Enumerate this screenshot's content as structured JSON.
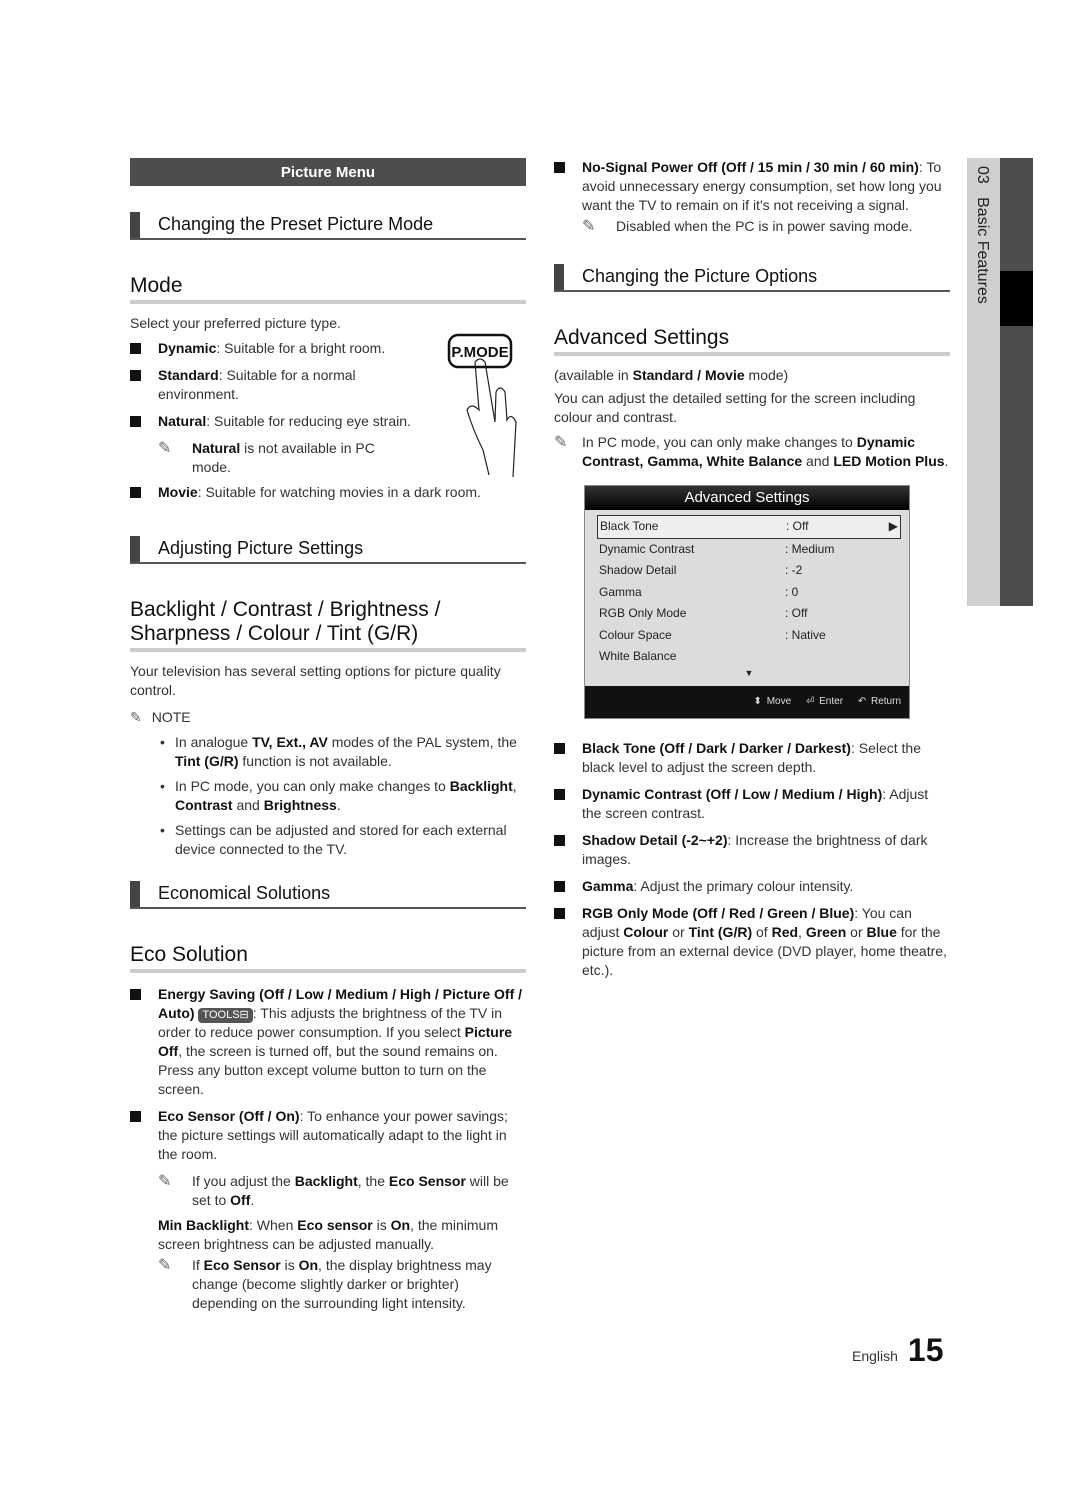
{
  "left": {
    "menu_bar": "Picture Menu",
    "sub1": "Changing the Preset Picture Mode",
    "h_mode": "Mode",
    "mode_intro": "Select your preferred picture type.",
    "mode_items": [
      {
        "term": "Dynamic",
        "text": ": Suitable for a bright room."
      },
      {
        "term": "Standard",
        "text": ": Suitable for a normal environment."
      },
      {
        "term": "Natural",
        "text": ": Suitable for reducing eye strain."
      }
    ],
    "natural_note_term": "Natural",
    "natural_note_text": " is not available in PC mode.",
    "movie_term": "Movie",
    "movie_text": ": Suitable for watching movies in a dark room.",
    "pmode_label": "P.MODE",
    "sub2": "Adjusting Picture Settings",
    "h_backlight": "Backlight / Contrast / Brightness / Sharpness / Colour / Tint (G/R)",
    "backlight_intro": "Your television has several setting options for picture quality control.",
    "note_label": "NOTE",
    "notes": [
      {
        "a": "In analogue ",
        "b": "TV, Ext., AV",
        "c": " modes of the PAL system, the ",
        "d": "Tint (G/R)",
        "e": " function is not available."
      },
      {
        "a": "In PC mode, you can only make changes to ",
        "b": "Backlight",
        "c": ", ",
        "d": "Contrast",
        "e": " and ",
        "f": "Brightness",
        "g": "."
      },
      {
        "a": "Settings can be adjusted and stored for each external device connected to the TV."
      }
    ],
    "sub3": "Economical Solutions",
    "h_eco": "Eco Solution",
    "energy_term": "Energy Saving (Off / Low / Medium / High / Picture Off / Auto)",
    "tools_label": "TOOLS",
    "energy_text1": ": This adjusts the brightness of the TV in order to reduce power consumption. If you select ",
    "energy_term2": "Picture Off",
    "energy_text2": ", the screen is turned off, but the sound remains on. Press any button except volume button to turn on the screen.",
    "eco_sensor_term": "Eco Sensor (Off / On)",
    "eco_sensor_text": ": To enhance your power savings; the picture settings will automatically adapt to the light in the room.",
    "eco_note": {
      "a": "If you adjust the ",
      "b": "Backlight",
      "c": ", the ",
      "d": "Eco Sensor",
      "e": " will be set to ",
      "f": "Off",
      "g": "."
    },
    "min_backlight": {
      "a": "Min Backlight",
      "b": ": When ",
      "c": "Eco sensor",
      "d": " is ",
      "e": "On",
      "f": ", the minimum screen brightness can be adjusted manually."
    },
    "min_note": {
      "a": "If ",
      "b": "Eco Sensor",
      "c": " is ",
      "d": "On",
      "e": ", the display brightness may change (become slightly darker or brighter) depending on the surrounding light intensity."
    }
  },
  "right": {
    "nosignal_term": "No-Signal Power Off (Off / 15 min / 30 min / 60 min)",
    "nosignal_text": ": To avoid unnecessary energy consumption, set how long you want the TV to remain on if it's not receiving a signal.",
    "nosignal_note": "Disabled when the PC is in power saving mode.",
    "sub4": "Changing the Picture Options",
    "h_adv": "Advanced Settings",
    "avail": {
      "a": "(available in ",
      "b": "Standard / Movie",
      "c": " mode)"
    },
    "adv_intro": "You can adjust the detailed setting for the screen including colour and contrast.",
    "pc_note": {
      "a": "In PC mode, you can only make changes to ",
      "b": "Dynamic Contrast, Gamma, White Balance",
      "c": " and ",
      "d": "LED Motion Plus",
      "e": "."
    },
    "osd": {
      "title": "Advanced Settings",
      "rows": [
        {
          "key": "Black Tone",
          "value": ": Off"
        },
        {
          "key": "Dynamic Contrast",
          "value": ": Medium"
        },
        {
          "key": "Shadow Detail",
          "value": ": -2"
        },
        {
          "key": "Gamma",
          "value": ": 0"
        },
        {
          "key": "RGB Only Mode",
          "value": ": Off"
        },
        {
          "key": "Colour Space",
          "value": ": Native"
        },
        {
          "key": "White Balance",
          "value": ""
        }
      ],
      "footer": {
        "move": "Move",
        "enter": "Enter",
        "return": "Return"
      }
    },
    "items": [
      {
        "term": "Black Tone (Off / Dark / Darker / Darkest)",
        "text": ": Select the black level to adjust the screen depth."
      },
      {
        "term": "Dynamic Contrast (Off / Low / Medium / High)",
        "text": ": Adjust the screen contrast."
      },
      {
        "term": "Shadow Detail (-2~+2)",
        "text": ": Increase the brightness of dark images."
      },
      {
        "term": "Gamma",
        "text": ": Adjust the primary colour intensity."
      }
    ],
    "rgb": {
      "a": "RGB Only Mode (Off / Red / Green / Blue)",
      "b": ": You can adjust ",
      "c": "Colour",
      "d": " or ",
      "e": "Tint (G/R)",
      "f": " of ",
      "g": "Red",
      "h": ", ",
      "i": "Green",
      "j": " or ",
      "k": "Blue",
      "l": " for the picture from an external device (DVD player, home theatre, etc.)."
    }
  },
  "side_tab": "03   Basic Features",
  "footer": {
    "language": "English",
    "page": "15"
  }
}
